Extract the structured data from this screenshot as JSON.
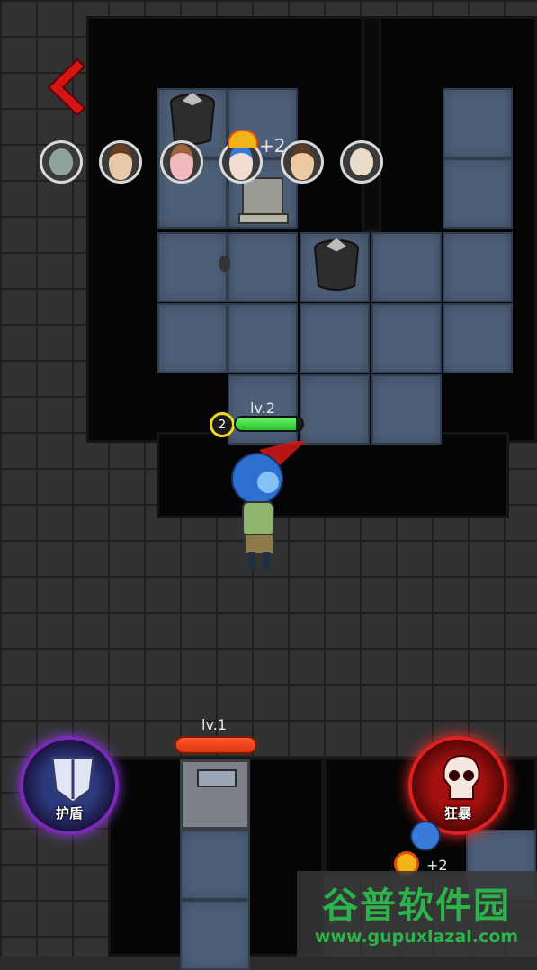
{
  "header": {
    "back_icon": "back-arrow-icon",
    "back_color": "#e01a1a"
  },
  "team": {
    "avatars": [
      {
        "name": "green-haired-survivor-avatar"
      },
      {
        "name": "sunglasses-brown-hair-avatar"
      },
      {
        "name": "pink-face-avatar"
      },
      {
        "name": "blue-haired-survivor-avatar"
      },
      {
        "name": "brown-hair-survivor-avatar"
      },
      {
        "name": "bald-glasses-avatar"
      }
    ],
    "extra_count_top": "+2",
    "extra_count_bottom": "+2"
  },
  "player": {
    "level": "lv.2",
    "coin_count": "2",
    "health_fraction": 0.9,
    "health_color": "#3bd83a"
  },
  "enemy_door": {
    "level": "lv.1",
    "bar_color": "#f0461a"
  },
  "skills": {
    "shield_label": "护盾",
    "rage_label": "狂暴"
  },
  "watermark": {
    "name": "谷普软件园",
    "url": "www.gupuxlazal.com"
  }
}
